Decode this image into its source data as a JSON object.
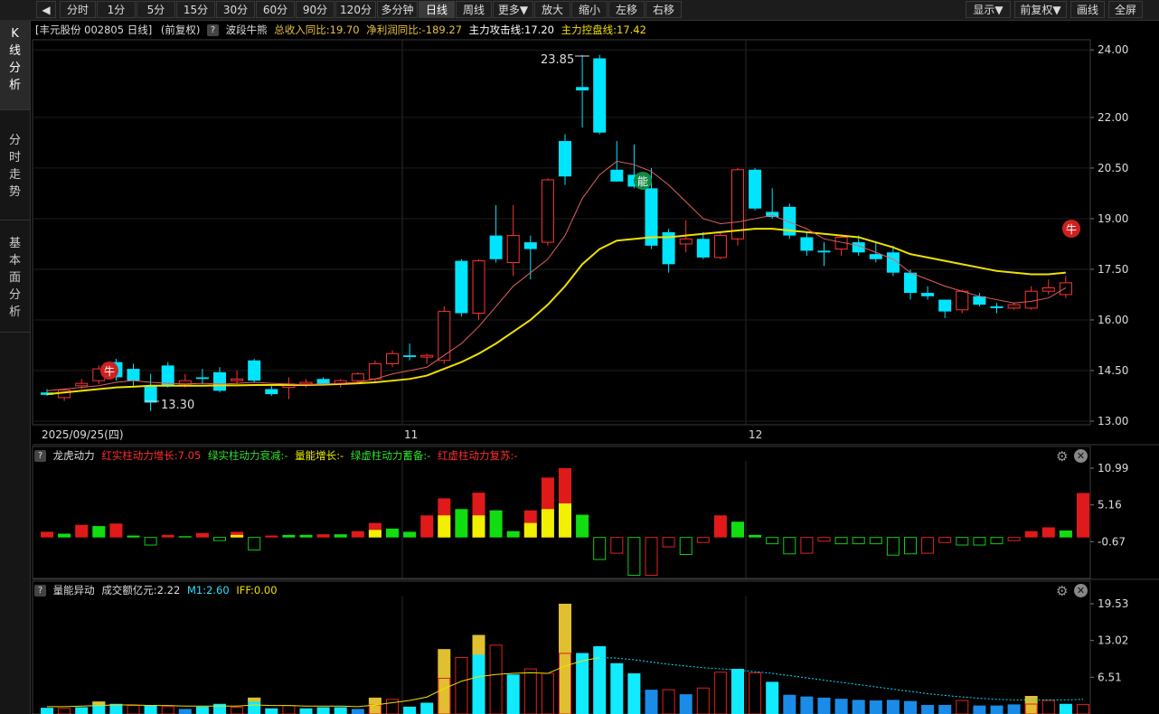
{
  "toolbar": {
    "left_items": [
      "分时",
      "1分",
      "5分",
      "15分",
      "30分",
      "60分",
      "90分",
      "120分",
      "多分钟",
      "日线",
      "周线",
      "更多▼",
      "放大",
      "缩小",
      "左移",
      "右移"
    ],
    "active": "日线",
    "right_items": [
      "显示▼",
      "前复权▼",
      "画线",
      "全屏"
    ]
  },
  "left_rail": {
    "tabs": [
      {
        "label": "K线分析",
        "active": true
      },
      {
        "label": "分时走势",
        "active": false
      },
      {
        "label": "基本面分析",
        "active": false
      }
    ]
  },
  "main_info": {
    "stock": "[丰元股份 002805 日线]",
    "adjust": "(前复权)",
    "indicator": "波段牛熊",
    "revenue": "总收入同比:19.70",
    "profit": "净利润同比:-189.27",
    "attack": "主力攻击线:17.20",
    "control": "主力控盘线:17.42"
  },
  "main_chart": {
    "price_ticks": [
      "24.00",
      "22.00",
      "20.50",
      "19.00",
      "17.50",
      "16.00",
      "14.50",
      "13.00"
    ],
    "date_labels": [
      "2025/09/25(四)",
      "11",
      "12"
    ],
    "high_label": "23.85",
    "low_label": "13.30",
    "badges": [
      "牛",
      "能",
      "牛"
    ]
  },
  "panel2": {
    "name": "龙虎动力",
    "items": [
      "红实柱动力增长:7.05",
      "绿实柱动力衰减:-",
      "量能增长:-",
      "绿虚柱动力蓄备:-",
      "红虚柱动力复苏:-"
    ],
    "ticks": [
      "10.99",
      "5.16",
      "-0.67"
    ]
  },
  "panel3": {
    "name": "量能异动",
    "items": [
      "成交额亿元:2.22",
      "M1:2.60",
      "IFF:0.00"
    ],
    "ticks": [
      "19.53",
      "13.02",
      "6.51"
    ]
  },
  "chart_data": {
    "type": "candlestick",
    "candles": [
      [
        13.85,
        13.95,
        13.75,
        13.78
      ],
      [
        13.7,
        13.95,
        13.6,
        13.92
      ],
      [
        14.05,
        14.25,
        13.95,
        14.12
      ],
      [
        14.2,
        14.65,
        14.1,
        14.55
      ],
      [
        14.75,
        14.85,
        14.2,
        14.3
      ],
      [
        14.55,
        14.7,
        14.05,
        14.2
      ],
      [
        14.05,
        14.4,
        13.3,
        13.55
      ],
      [
        14.65,
        14.75,
        14.0,
        14.05
      ],
      [
        14.1,
        14.4,
        14.0,
        14.2
      ],
      [
        14.3,
        14.55,
        14.1,
        14.25
      ],
      [
        14.45,
        14.6,
        13.85,
        13.9
      ],
      [
        14.2,
        14.5,
        14.1,
        14.25
      ],
      [
        14.8,
        14.85,
        14.15,
        14.2
      ],
      [
        13.95,
        14.05,
        13.75,
        13.8
      ],
      [
        14.0,
        14.3,
        13.65,
        14.1
      ],
      [
        14.1,
        14.25,
        14.0,
        14.15
      ],
      [
        14.25,
        14.3,
        14.05,
        14.1
      ],
      [
        14.1,
        14.25,
        14.0,
        14.2
      ],
      [
        14.2,
        14.45,
        14.1,
        14.4
      ],
      [
        14.25,
        14.8,
        14.15,
        14.7
      ],
      [
        14.7,
        15.1,
        14.6,
        15.0
      ],
      [
        14.95,
        15.3,
        14.8,
        14.9
      ],
      [
        14.9,
        15.0,
        14.7,
        14.95
      ],
      [
        14.8,
        16.4,
        14.7,
        16.25
      ],
      [
        17.75,
        17.8,
        16.1,
        16.2
      ],
      [
        16.2,
        17.8,
        16.0,
        17.75
      ],
      [
        18.5,
        19.4,
        17.7,
        17.8
      ],
      [
        17.7,
        19.4,
        17.3,
        18.5
      ],
      [
        18.3,
        18.5,
        17.2,
        18.1
      ],
      [
        18.3,
        20.2,
        18.2,
        20.15
      ],
      [
        21.3,
        21.5,
        20.0,
        20.25
      ],
      [
        22.9,
        23.85,
        21.7,
        22.8
      ],
      [
        23.75,
        23.85,
        21.5,
        21.55
      ],
      [
        20.45,
        21.3,
        20.1,
        20.1
      ],
      [
        20.3,
        21.2,
        19.9,
        19.95
      ],
      [
        19.9,
        20.5,
        18.1,
        18.2
      ],
      [
        18.6,
        18.7,
        17.4,
        17.65
      ],
      [
        18.25,
        18.95,
        18.0,
        18.4
      ],
      [
        18.4,
        18.6,
        17.8,
        17.85
      ],
      [
        17.85,
        18.6,
        17.8,
        18.5
      ],
      [
        18.4,
        20.5,
        18.2,
        20.45
      ],
      [
        20.45,
        20.5,
        19.25,
        19.3
      ],
      [
        19.2,
        19.9,
        19.0,
        19.05
      ],
      [
        19.35,
        19.45,
        18.4,
        18.5
      ],
      [
        18.45,
        18.6,
        17.9,
        18.05
      ],
      [
        18.05,
        18.3,
        17.6,
        18.0
      ],
      [
        18.1,
        18.5,
        17.9,
        18.45
      ],
      [
        18.3,
        18.5,
        17.9,
        18.0
      ],
      [
        17.95,
        18.3,
        17.7,
        17.8
      ],
      [
        18.0,
        18.2,
        17.3,
        17.4
      ],
      [
        17.4,
        17.5,
        16.6,
        16.8
      ],
      [
        16.8,
        17.0,
        16.6,
        16.7
      ],
      [
        16.6,
        16.6,
        16.05,
        16.25
      ],
      [
        16.3,
        16.9,
        16.2,
        16.85
      ],
      [
        16.7,
        16.8,
        16.4,
        16.45
      ],
      [
        16.4,
        16.5,
        16.2,
        16.35
      ],
      [
        16.35,
        16.5,
        16.3,
        16.45
      ],
      [
        16.35,
        17.0,
        16.3,
        16.85
      ],
      [
        16.85,
        17.2,
        16.75,
        16.95
      ],
      [
        16.75,
        17.3,
        16.65,
        17.1
      ]
    ],
    "ma_white": [
      13.9,
      13.95,
      14.0,
      14.05,
      14.15,
      14.2,
      14.15,
      14.12,
      14.1,
      14.12,
      14.1,
      14.12,
      14.15,
      14.12,
      14.1,
      14.08,
      14.1,
      14.12,
      14.15,
      14.25,
      14.4,
      14.5,
      14.6,
      14.95,
      15.3,
      15.8,
      16.4,
      17.0,
      17.4,
      17.8,
      18.5,
      19.6,
      20.3,
      20.7,
      20.6,
      20.4,
      20.0,
      19.5,
      19.0,
      18.85,
      18.9,
      19.0,
      19.1,
      18.9,
      18.7,
      18.4,
      18.3,
      18.2,
      18.0,
      17.8,
      17.4,
      17.2,
      17.0,
      16.85,
      16.7,
      16.6,
      16.5,
      16.55,
      16.65,
      16.95
    ],
    "ma_yellow": [
      13.8,
      13.85,
      13.9,
      13.95,
      14.0,
      14.02,
      14.05,
      14.05,
      14.05,
      14.05,
      14.06,
      14.06,
      14.07,
      14.07,
      14.07,
      14.07,
      14.08,
      14.1,
      14.12,
      14.15,
      14.2,
      14.25,
      14.35,
      14.55,
      14.75,
      15.0,
      15.3,
      15.65,
      16.0,
      16.45,
      17.0,
      17.65,
      18.1,
      18.35,
      18.4,
      18.45,
      18.45,
      18.5,
      18.55,
      18.6,
      18.65,
      18.7,
      18.7,
      18.65,
      18.6,
      18.55,
      18.5,
      18.45,
      18.3,
      18.15,
      17.95,
      17.85,
      17.75,
      17.65,
      17.55,
      17.45,
      17.4,
      17.35,
      17.35,
      17.4
    ],
    "ylim": [
      13.0,
      24.3
    ]
  },
  "panel2_data": {
    "bars": [
      {
        "v": 0.9,
        "t": "rs"
      },
      {
        "v": 0.6,
        "t": "gs"
      },
      {
        "v": 2.0,
        "t": "rs"
      },
      {
        "v": 1.8,
        "t": "gs"
      },
      {
        "v": 2.2,
        "t": "rs"
      },
      {
        "v": 0.3,
        "t": "gs"
      },
      {
        "v": -1.2,
        "t": "gh"
      },
      {
        "v": 0.4,
        "t": "rs"
      },
      {
        "v": 0.2,
        "t": "gs"
      },
      {
        "v": 0.7,
        "t": "rs"
      },
      {
        "v": -0.5,
        "t": "gh"
      },
      {
        "v": 0.9,
        "t": "ry",
        "y": 0.4
      },
      {
        "v": -2.0,
        "t": "gh"
      },
      {
        "v": 0.3,
        "t": "rs"
      },
      {
        "v": 0.4,
        "t": "gs"
      },
      {
        "v": 0.4,
        "t": "gs"
      },
      {
        "v": 0.5,
        "t": "rs"
      },
      {
        "v": 0.5,
        "t": "gs"
      },
      {
        "v": 1.0,
        "t": "rs"
      },
      {
        "v": 2.3,
        "t": "ry",
        "y": 1.2
      },
      {
        "v": 1.4,
        "t": "gs"
      },
      {
        "v": 0.9,
        "t": "gs"
      },
      {
        "v": 3.5,
        "t": "rs"
      },
      {
        "v": 6.2,
        "t": "ry",
        "y": 3.5
      },
      {
        "v": 4.5,
        "t": "gs"
      },
      {
        "v": 7.1,
        "t": "ry",
        "y": 3.5
      },
      {
        "v": 4.3,
        "t": "gs"
      },
      {
        "v": 1.0,
        "t": "gs"
      },
      {
        "v": 4.3,
        "t": "ry",
        "y": 2.3
      },
      {
        "v": 9.5,
        "t": "ry",
        "y": 4.5
      },
      {
        "v": 10.99,
        "t": "ry",
        "y": 5.4
      },
      {
        "v": 3.6,
        "t": "gs"
      },
      {
        "v": -3.5,
        "t": "gh"
      },
      {
        "v": -2.5,
        "t": "rh"
      },
      {
        "v": -6.0,
        "t": "gh"
      },
      {
        "v": -6.0,
        "t": "rh"
      },
      {
        "v": -1.5,
        "t": "rh"
      },
      {
        "v": -2.7,
        "t": "gh"
      },
      {
        "v": -0.8,
        "t": "rh"
      },
      {
        "v": 3.5,
        "t": "rs"
      },
      {
        "v": 2.5,
        "t": "gs"
      },
      {
        "v": 0.4,
        "t": "gs"
      },
      {
        "v": -1.0,
        "t": "gh"
      },
      {
        "v": -2.6,
        "t": "gh"
      },
      {
        "v": -2.5,
        "t": "rh"
      },
      {
        "v": -0.6,
        "t": "rh"
      },
      {
        "v": -1.0,
        "t": "gh"
      },
      {
        "v": -1.0,
        "t": "gh"
      },
      {
        "v": -1.0,
        "t": "gh"
      },
      {
        "v": -2.8,
        "t": "gh"
      },
      {
        "v": -2.6,
        "t": "gh"
      },
      {
        "v": -2.5,
        "t": "rh"
      },
      {
        "v": -0.8,
        "t": "rh"
      },
      {
        "v": -1.2,
        "t": "gh"
      },
      {
        "v": -1.2,
        "t": "gh"
      },
      {
        "v": -1.0,
        "t": "gh"
      },
      {
        "v": -0.5,
        "t": "rh"
      },
      {
        "v": 1.0,
        "t": "rs"
      },
      {
        "v": 1.6,
        "t": "rs"
      },
      {
        "v": 1.1,
        "t": "gs"
      },
      {
        "v": 7.05,
        "t": "rs"
      }
    ]
  },
  "panel3_data": {
    "bars": [
      {
        "v": 1.1,
        "c": "c"
      },
      {
        "v": 1.0,
        "c": "ro"
      },
      {
        "v": 1.2,
        "c": "c"
      },
      {
        "v": 2.2,
        "c": "cy"
      },
      {
        "v": 1.8,
        "c": "c"
      },
      {
        "v": 1.5,
        "c": "ro"
      },
      {
        "v": 1.6,
        "c": "c"
      },
      {
        "v": 1.3,
        "c": "ro"
      },
      {
        "v": 0.9,
        "c": "b"
      },
      {
        "v": 1.3,
        "c": "c"
      },
      {
        "v": 1.8,
        "c": "c"
      },
      {
        "v": 1.2,
        "c": "ro"
      },
      {
        "v": 2.9,
        "c": "cy"
      },
      {
        "v": 1.0,
        "c": "c"
      },
      {
        "v": 1.5,
        "c": "ro"
      },
      {
        "v": 1.0,
        "c": "c"
      },
      {
        "v": 1.2,
        "c": "c"
      },
      {
        "v": 1.2,
        "c": "c"
      },
      {
        "v": 0.9,
        "c": "b"
      },
      {
        "v": 2.9,
        "c": "ry"
      },
      {
        "v": 2.6,
        "c": "ro"
      },
      {
        "v": 1.3,
        "c": "c"
      },
      {
        "v": 2.0,
        "c": "c"
      },
      {
        "v": 11.5,
        "c": "ry"
      },
      {
        "v": 10.0,
        "c": "ro"
      },
      {
        "v": 14.0,
        "c": "cy"
      },
      {
        "v": 12.2,
        "c": "ro"
      },
      {
        "v": 7.0,
        "c": "c"
      },
      {
        "v": 8.0,
        "c": "ro"
      },
      {
        "v": 7.2,
        "c": "ro"
      },
      {
        "v": 19.53,
        "c": "ry"
      },
      {
        "v": 10.8,
        "c": "c"
      },
      {
        "v": 12.0,
        "c": "c"
      },
      {
        "v": 9.0,
        "c": "c"
      },
      {
        "v": 7.2,
        "c": "c"
      },
      {
        "v": 4.3,
        "c": "b"
      },
      {
        "v": 4.3,
        "c": "ro"
      },
      {
        "v": 3.5,
        "c": "b"
      },
      {
        "v": 4.6,
        "c": "ro"
      },
      {
        "v": 7.4,
        "c": "ro"
      },
      {
        "v": 8.0,
        "c": "c"
      },
      {
        "v": 7.3,
        "c": "ro"
      },
      {
        "v": 5.7,
        "c": "c"
      },
      {
        "v": 3.4,
        "c": "b"
      },
      {
        "v": 3.1,
        "c": "b"
      },
      {
        "v": 2.9,
        "c": "b"
      },
      {
        "v": 2.7,
        "c": "b"
      },
      {
        "v": 2.5,
        "c": "b"
      },
      {
        "v": 2.4,
        "c": "b"
      },
      {
        "v": 2.5,
        "c": "b"
      },
      {
        "v": 2.3,
        "c": "b"
      },
      {
        "v": 1.6,
        "c": "b"
      },
      {
        "v": 1.6,
        "c": "b"
      },
      {
        "v": 2.4,
        "c": "ro"
      },
      {
        "v": 1.5,
        "c": "b"
      },
      {
        "v": 1.5,
        "c": "b"
      },
      {
        "v": 1.7,
        "c": "b"
      },
      {
        "v": 3.2,
        "c": "ry"
      },
      {
        "v": 2.4,
        "c": "ro"
      },
      {
        "v": 1.8,
        "c": "c"
      },
      {
        "v": 1.7,
        "c": "ro"
      }
    ],
    "m1": [
      1.3,
      1.3,
      1.4,
      1.5,
      1.6,
      1.6,
      1.5,
      1.5,
      1.4,
      1.4,
      1.4,
      1.4,
      1.6,
      1.5,
      1.5,
      1.4,
      1.4,
      1.4,
      1.3,
      1.6,
      2.0,
      2.4,
      3.0,
      4.5,
      5.8,
      6.6,
      7.0,
      7.2,
      7.3,
      7.2,
      8.5,
      9.4,
      10.0,
      9.9,
      9.6,
      9.2,
      8.8,
      8.5,
      8.2,
      8.0,
      7.8,
      7.5,
      7.2,
      6.8,
      6.4,
      6.0,
      5.6,
      5.2,
      4.8,
      4.4,
      4.0,
      3.6,
      3.3,
      3.0,
      2.8,
      2.6,
      2.5,
      2.5,
      2.5,
      2.5,
      2.6
    ]
  }
}
